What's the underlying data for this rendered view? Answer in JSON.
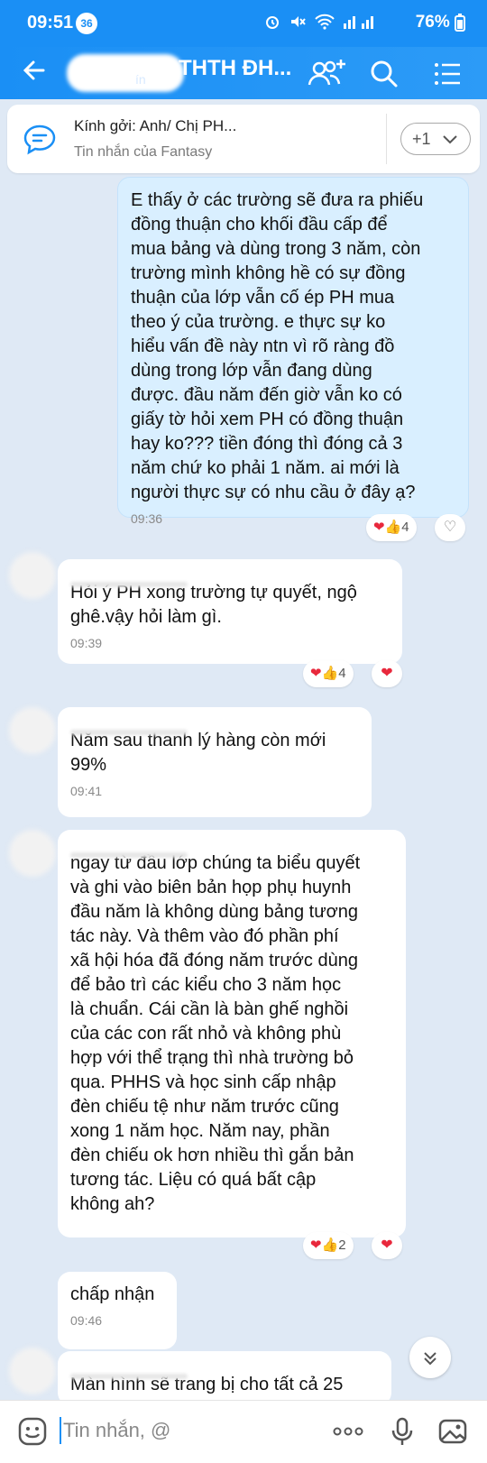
{
  "status_bar": {
    "time": "09:51",
    "notification_count": "36",
    "battery": "76%"
  },
  "header": {
    "title": "THTH ĐH...",
    "subtitle": "ín",
    "icons": [
      "back-arrow-icon",
      "add-member-icon",
      "search-icon",
      "menu-list-icon"
    ]
  },
  "pinned": {
    "title": "Kính gởi: Anh/ Chị PH...",
    "subtitle": "Tin nhắn của Fantasy",
    "more_label": "+1"
  },
  "messages": [
    {
      "side": "mine",
      "text": "E thấy ở các trường sẽ đưa ra phiếu\nđồng thuận cho khối đầu cấp để\nmua bảng và dùng trong 3 năm, còn\ntrường mình không hề có sự đồng\nthuận của lớp vẫn cố ép PH mua\ntheo ý của trường. e thực sự ko\nhiểu vấn đề này ntn vì rõ ràng đồ\ndùng trong lớp vẫn đang dùng\nđược. đầu năm đến giờ vẫn ko có\ngiấy tờ hỏi xem PH có đồng thuận\nhay ko??? tiền đóng thì đóng cả 3\nnăm chứ ko phải 1 năm. ai mới là\nngười thực sự có nhu cầu ở đây ạ?",
      "time": "09:36",
      "reaction_count": "4"
    },
    {
      "side": "theirs",
      "text": "Hỏi ý PH xong trường tự quyết, ngộ\nghê.vậy hỏi làm gì.",
      "time": "09:39",
      "reaction_count": "4"
    },
    {
      "side": "theirs",
      "text": "Năm sau thanh lý hàng còn mới\n99%",
      "time": "09:41"
    },
    {
      "side": "theirs",
      "text": "ngay từ đầu lớp chúng ta biểu quyết\nvà ghi vào biên bản họp phụ huynh\nđầu năm là không dùng bảng tương\ntác này. Và thêm vào đó phần phí\nxã hội hóa đã đóng năm trước dùng\nđể bảo trì các kiểu cho 3 năm học\nlà chuẩn. Cái cần là bàn ghế nghồi\ncủa các con rất nhỏ và không phù\nhợp với thể trạng thì nhà trường bỏ\nqua. PHHS và học sinh cấp nhập\nđèn chiếu tệ như năm trước cũng\nxong 1 năm học. Năm nay, phần\nđèn chiếu ok hơn nhiều thì gắn bản\ntương tác. Liệu có quá bất cập\nkhông ah?",
      "reaction_count": "2"
    },
    {
      "side": "theirs",
      "text": "chấp nhận",
      "time": "09:46"
    },
    {
      "side": "theirs",
      "text": "Màn hình sẽ trang bị cho tất cả 25"
    }
  ],
  "input": {
    "placeholder": "Tin nhắn, @",
    "icons": [
      "emoji-icon",
      "more-dots-icon",
      "microphone-icon",
      "image-icon"
    ]
  },
  "colors": {
    "accent": "#1a8ff5",
    "mine_bubble": "#d9efff",
    "chat_bg": "#dfe9f5",
    "heart": "#e8283c"
  }
}
